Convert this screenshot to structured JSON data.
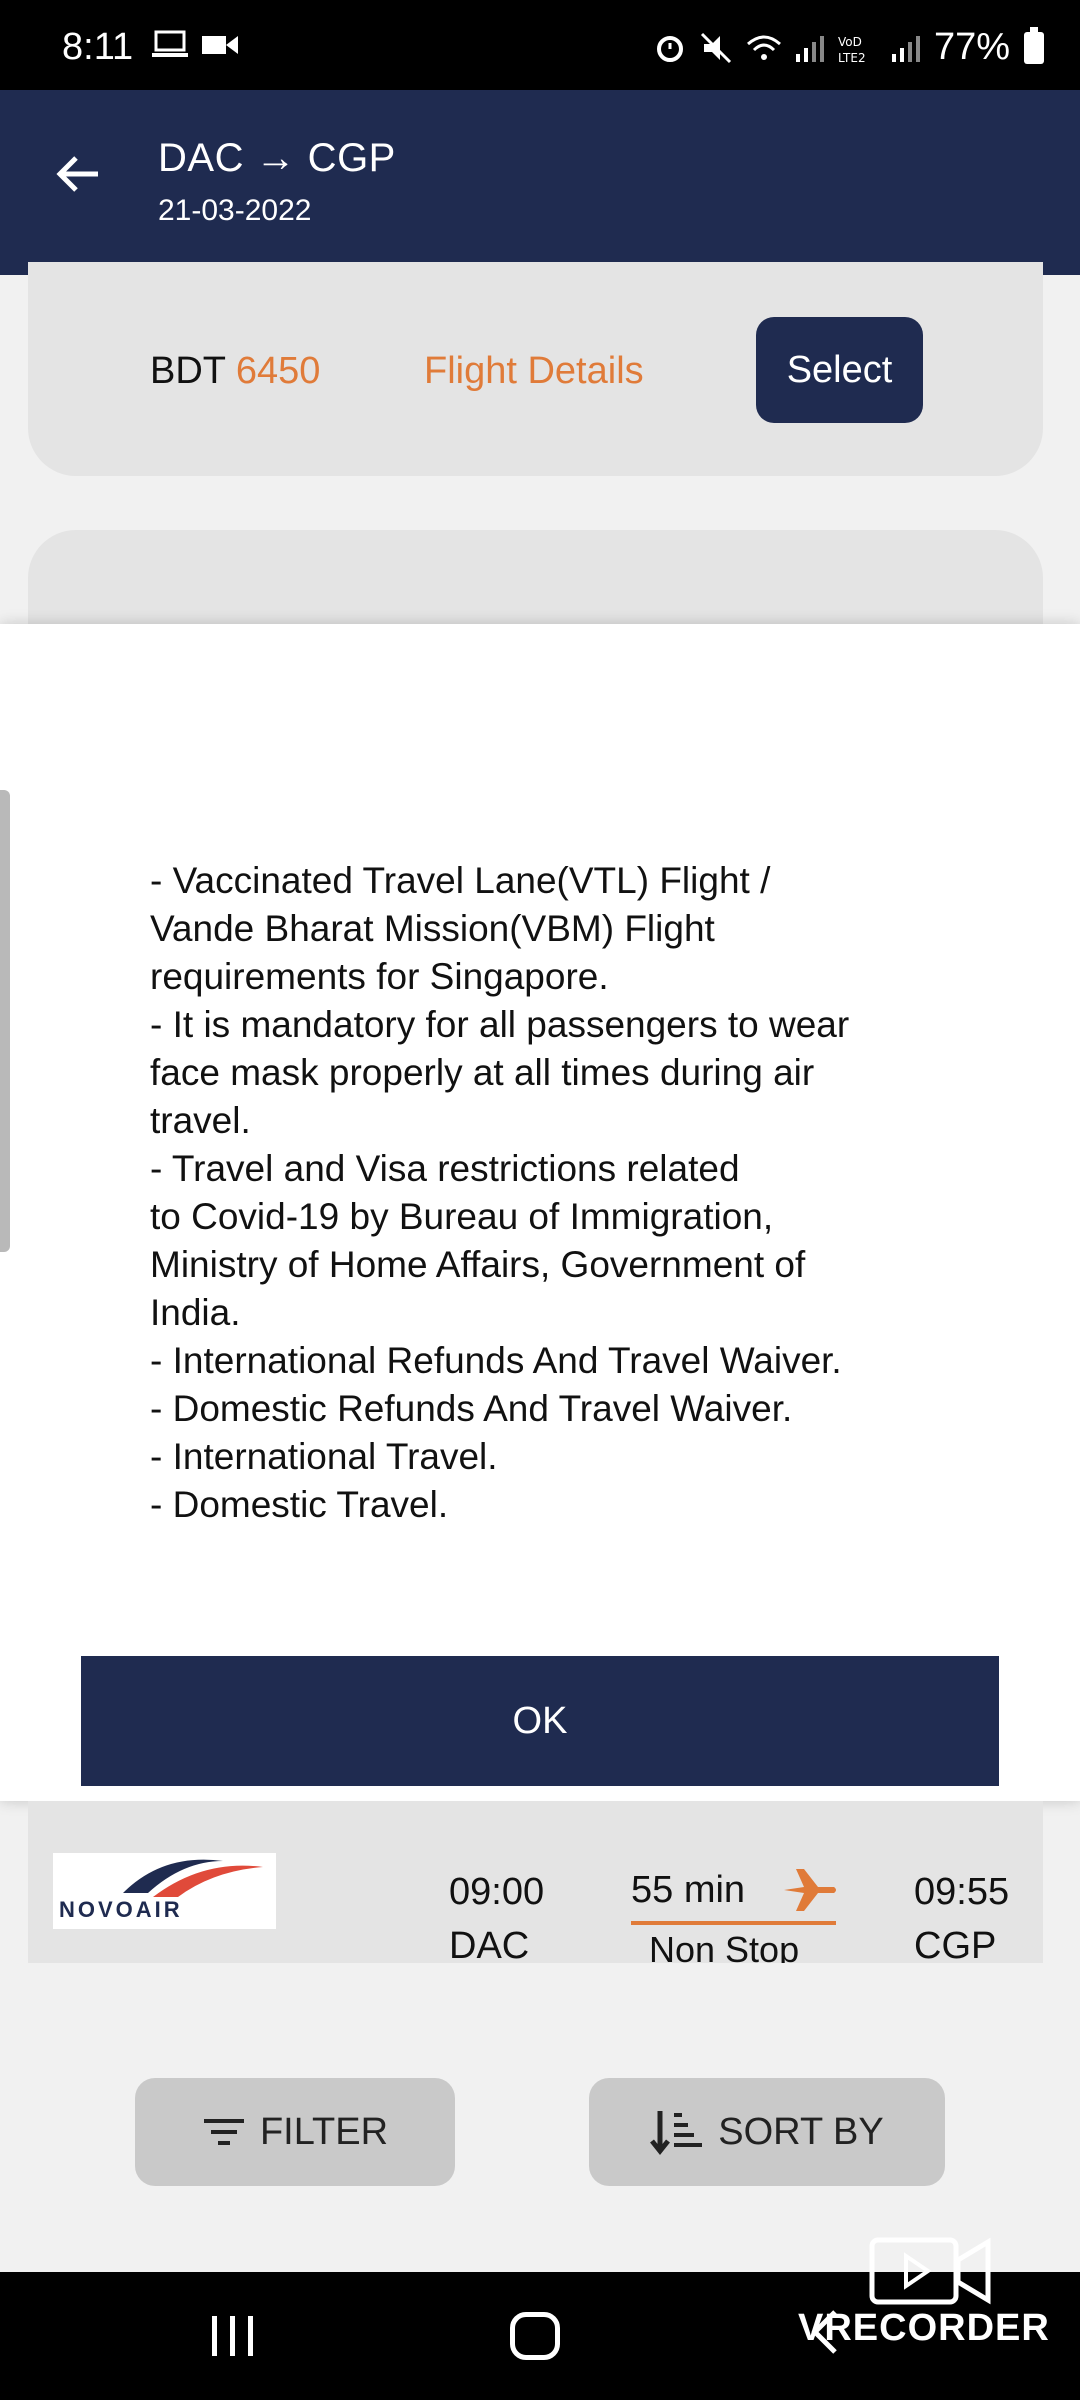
{
  "status_bar": {
    "time": "8:11",
    "battery": "77%",
    "icons_left": [
      "laptop-icon",
      "video-icon"
    ],
    "icons_right": [
      "alarm-icon",
      "mute-icon",
      "wifi-icon",
      "signal-icon",
      "volte-icon",
      "signal-icon",
      "battery-icon"
    ]
  },
  "header": {
    "route": "DAC → CGP",
    "date": "21-03-2022"
  },
  "top_card": {
    "currency": "BDT",
    "price": "6450",
    "details_label": "Flight Details",
    "select_label": "Select"
  },
  "dialog": {
    "lines": [
      "- Vaccinated Travel Lane(VTL) Flight /",
      "Vande Bharat Mission(VBM) Flight",
      "requirements for Singapore.",
      "- It is mandatory for all passengers to wear",
      "face mask properly at all times during air",
      "travel.",
      "- Travel and Visa restrictions related",
      "to Covid-19 by Bureau of Immigration,",
      "Ministry of Home Affairs, Government of",
      "India.",
      "- International Refunds And Travel Waiver.",
      "- Domestic Refunds And Travel Waiver.",
      "- International Travel.",
      "- Domestic Travel."
    ],
    "ok_label": "OK"
  },
  "flight": {
    "airline": "NOVOAIR",
    "departure_time": "09:00",
    "departure_code": "DAC",
    "duration": "55 min",
    "stops": "Non Stop",
    "arrival_time": "09:55",
    "arrival_code": "CGP"
  },
  "bottom": {
    "filter_label": "FILTER",
    "sort_label": "SORT BY"
  },
  "watermark": "VRECORDER",
  "colors": {
    "primary": "#1f2b50",
    "accent": "#e07b39",
    "card": "#e4e4e4"
  }
}
